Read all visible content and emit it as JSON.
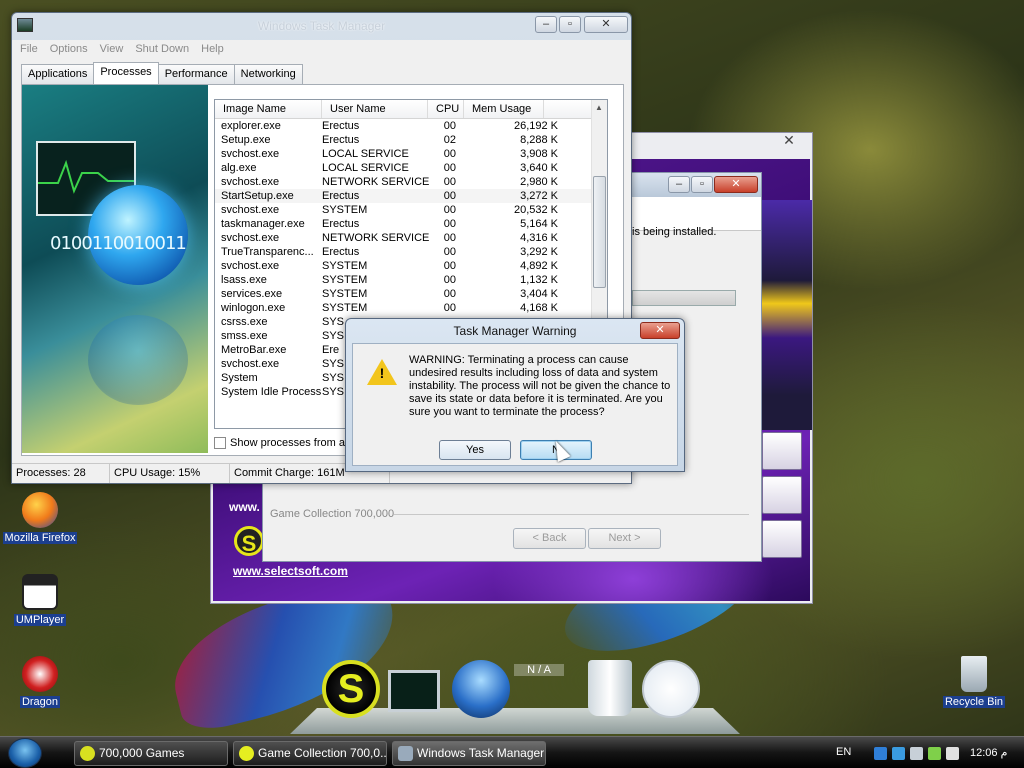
{
  "desktop": {
    "icons": [
      {
        "label": "Mozilla Firefox"
      },
      {
        "label": "UMPlayer"
      },
      {
        "label": "Dragon"
      },
      {
        "label": "Recycle Bin"
      }
    ],
    "dock_badge": "N / A"
  },
  "installer": {
    "status_text": "is being installed.",
    "group_label": "Game Collection 700,000",
    "back_label": "< Back",
    "next_label": "Next >",
    "link_text": "www.selectsoft.com",
    "link_text_partial": "www.",
    "logo_letter": "S"
  },
  "task_manager": {
    "title": "Windows Task Manager",
    "menu": [
      "File",
      "Options",
      "View",
      "Shut Down",
      "Help"
    ],
    "tabs": [
      "Applications",
      "Processes",
      "Performance",
      "Networking"
    ],
    "active_tab": "Processes",
    "art_text": "0100110010011",
    "columns": [
      "Image Name",
      "User Name",
      "CPU",
      "Mem Usage"
    ],
    "processes": [
      {
        "name": "explorer.exe",
        "user": "Erectus",
        "cpu": "00",
        "mem": "26,192 K"
      },
      {
        "name": "Setup.exe",
        "user": "Erectus",
        "cpu": "02",
        "mem": "8,288 K"
      },
      {
        "name": "svchost.exe",
        "user": "LOCAL SERVICE",
        "cpu": "00",
        "mem": "3,908 K"
      },
      {
        "name": "alg.exe",
        "user": "LOCAL SERVICE",
        "cpu": "00",
        "mem": "3,640 K"
      },
      {
        "name": "svchost.exe",
        "user": "NETWORK SERVICE",
        "cpu": "00",
        "mem": "2,980 K"
      },
      {
        "name": "StartSetup.exe",
        "user": "Erectus",
        "cpu": "00",
        "mem": "3,272 K"
      },
      {
        "name": "svchost.exe",
        "user": "SYSTEM",
        "cpu": "00",
        "mem": "20,532 K"
      },
      {
        "name": "taskmanager.exe",
        "user": "Erectus",
        "cpu": "00",
        "mem": "5,164 K"
      },
      {
        "name": "svchost.exe",
        "user": "NETWORK SERVICE",
        "cpu": "00",
        "mem": "4,316 K"
      },
      {
        "name": "TrueTransparenc...",
        "user": "Erectus",
        "cpu": "00",
        "mem": "3,292 K"
      },
      {
        "name": "svchost.exe",
        "user": "SYSTEM",
        "cpu": "00",
        "mem": "4,892 K"
      },
      {
        "name": "lsass.exe",
        "user": "SYSTEM",
        "cpu": "00",
        "mem": "1,132 K"
      },
      {
        "name": "services.exe",
        "user": "SYSTEM",
        "cpu": "00",
        "mem": "3,404 K"
      },
      {
        "name": "winlogon.exe",
        "user": "SYSTEM",
        "cpu": "00",
        "mem": "4,168 K"
      },
      {
        "name": "csrss.exe",
        "user": "SYS",
        "cpu": "",
        "mem": ""
      },
      {
        "name": "smss.exe",
        "user": "SYS",
        "cpu": "",
        "mem": ""
      },
      {
        "name": "MetroBar.exe",
        "user": "Ere",
        "cpu": "",
        "mem": ""
      },
      {
        "name": "svchost.exe",
        "user": "SYS",
        "cpu": "",
        "mem": ""
      },
      {
        "name": "System",
        "user": "SYS",
        "cpu": "",
        "mem": ""
      },
      {
        "name": "System Idle Process",
        "user": "SYS",
        "cpu": "",
        "mem": ""
      }
    ],
    "selected_row": 5,
    "show_all_label": "Show processes from all",
    "status": {
      "processes": "Processes: 28",
      "cpu": "CPU Usage: 15%",
      "commit": "Commit Charge: 161M"
    }
  },
  "warning": {
    "title": "Task Manager Warning",
    "message": "WARNING: Terminating a process can cause undesired results including loss of data and system instability. The process will not be given the chance to save its state or data before it is terminated.  Are you sure you want to terminate the process?",
    "icon_mark": "!",
    "yes_label": "Yes",
    "no_label": "N"
  },
  "taskbar": {
    "buttons": [
      {
        "label": "700,000 Games"
      },
      {
        "label": "Game Collection 700,0..."
      },
      {
        "label": "Windows Task Manager"
      }
    ],
    "tray_lang": "EN",
    "clock": "12:06 م"
  },
  "colors": {
    "taskbar": "#151515",
    "installer_purple": "#4a1490",
    "desktop_label_bg": "#1c3f8f"
  }
}
